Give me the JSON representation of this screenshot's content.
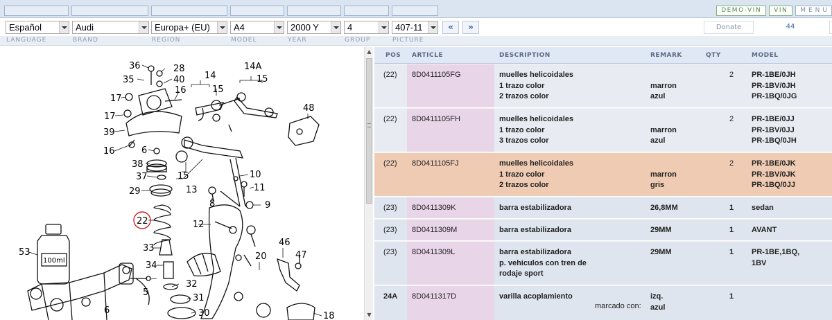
{
  "topbar": {
    "buttons": [
      "DEMO-VIN",
      "VIN",
      "MENU"
    ]
  },
  "selectors": {
    "language": "Español",
    "brand": "Audi",
    "region": "Europa+ (EU)",
    "model": "A4",
    "year": "2000  Y",
    "group": "4",
    "picture": "407-11",
    "prev_label": "«",
    "next_label": "»",
    "donate": "Donate",
    "count": "44"
  },
  "captions": {
    "language": "LANGUAGE",
    "brand": "BRAND",
    "region": "REGION",
    "model": "MODEL",
    "year": "YEAR",
    "group": "GROUP",
    "picture": "PICTURE"
  },
  "diagram": {
    "labels": [
      "36",
      "28",
      "35",
      "40",
      "16",
      "14",
      "14A",
      "15",
      "15",
      "17",
      "17",
      "48",
      "39",
      "16",
      "6",
      "38",
      "10",
      "37",
      "15",
      "13",
      "11",
      "29",
      "8",
      "9",
      "22",
      "12",
      "53",
      "100ml",
      "33",
      "46",
      "47",
      "34",
      "20",
      "5",
      "32",
      "31",
      "6",
      "30",
      "18"
    ]
  },
  "scroll": {
    "up": "▲",
    "down": "▼"
  },
  "table": {
    "headers": [
      "POS",
      "ARTICLE",
      "DESCRIPTION",
      "REMARK",
      "QTY",
      "MODEL"
    ],
    "rows": [
      {
        "pos": "(22)",
        "article": "8D0411105FG",
        "desc": [
          "muelles helicoidales",
          "1 trazo color",
          "2 trazos color"
        ],
        "remark": [
          "",
          "marron",
          "azul"
        ],
        "qty": "2",
        "model": [
          "PR-1BE/0JH",
          "PR-1BV/0JH",
          "PR-1BQ/0JG"
        ]
      },
      {
        "pos": "(22)",
        "article": "8D0411105FH",
        "desc": [
          "muelles helicoidales",
          "1 trazo color",
          "3 trazos color"
        ],
        "remark": [
          "",
          "marron",
          "azul"
        ],
        "qty": "2",
        "model": [
          "PR-1BE/0JJ",
          "PR-1BV/0JJ",
          "PR-1BQ/0JH"
        ]
      },
      {
        "pos": "(22)",
        "article": "8D0411105FJ",
        "desc": [
          "muelles helicoidales",
          "1 trazo color",
          "2 trazos color"
        ],
        "remark": [
          "",
          "marron",
          "gris"
        ],
        "qty": "2",
        "model": [
          "PR-1BE/0JK",
          "PR-1BV/0JK",
          "PR-1BQ/0JJ"
        ]
      },
      {
        "pos": "(23)",
        "article": "8D0411309K",
        "desc": [
          "barra estabilizadora"
        ],
        "remark": [
          "26,8MM"
        ],
        "qty": "1",
        "model": [
          "sedan"
        ]
      },
      {
        "pos": "(23)",
        "article": "8D0411309M",
        "desc": [
          "barra estabilizadora"
        ],
        "remark": [
          "29MM"
        ],
        "qty": "1",
        "model": [
          "AVANT"
        ]
      },
      {
        "pos": "(23)",
        "article": "8D0411309L",
        "desc": [
          "barra estabilizadora",
          "p. vehiculos con tren de",
          "rodaje sport"
        ],
        "remark": [
          "29MM"
        ],
        "qty": "1",
        "model": [
          "PR-1BE,1BQ,",
          "1BV"
        ]
      },
      {
        "pos": "24A",
        "article": "8D0411317D",
        "desc": [
          "varilla acoplamiento"
        ],
        "remark": [
          "izq.",
          "azul"
        ],
        "remark_prefix": "marcado con:",
        "qty": "1",
        "model": [
          ""
        ]
      }
    ]
  },
  "colors": {
    "highlight_row": "#efcbb3",
    "article_cell": "#e9d5e8",
    "header_bg": "#dfe8f4",
    "callout_circle": "#d42020"
  }
}
